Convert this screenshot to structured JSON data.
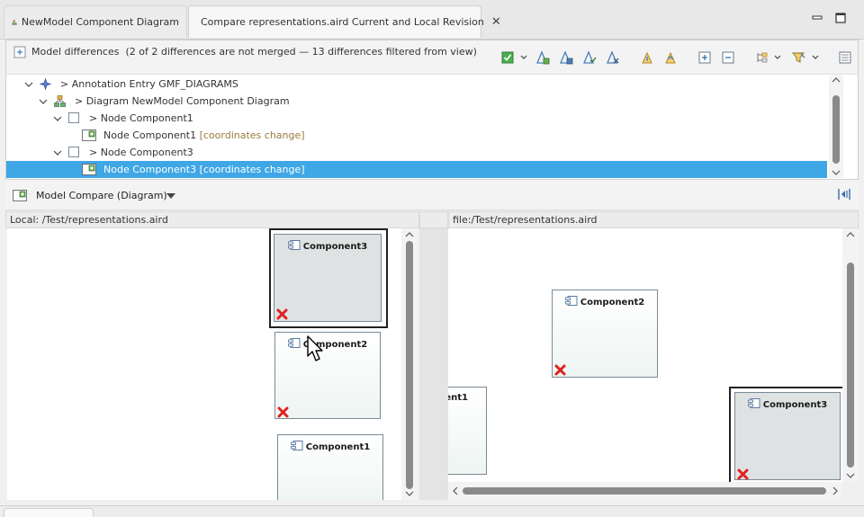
{
  "editor_tabs": [
    {
      "label": "NewModel Component Diagram",
      "active": false
    },
    {
      "label": "Compare representations.aird Current and Local Revision",
      "active": true
    }
  ],
  "model_differences": {
    "title": "Model differences",
    "status": "(2 of 2 differences are not merged — 13 differences filtered from view)",
    "tree": [
      {
        "text": "> Annotation Entry GMF_DIAGRAMS",
        "suffix": ""
      },
      {
        "text": "> Diagram  NewModel Component Diagram",
        "suffix": ""
      },
      {
        "text": "> Node Component1",
        "suffix": ""
      },
      {
        "text": "Node Component1",
        "suffix": "[coordinates change]"
      },
      {
        "text": "> Node Component3",
        "suffix": ""
      },
      {
        "text": "Node Component3",
        "suffix": "[coordinates change]",
        "selected": true
      }
    ]
  },
  "compare_viewer": {
    "title": "Model Compare (Diagram)",
    "left_pane_label": "Local: /Test/representations.aird",
    "right_pane_label": "file:/Test/representations.aird"
  },
  "diagram": {
    "left_nodes": [
      {
        "name": "Component3"
      },
      {
        "name": "Component2"
      },
      {
        "name": "Component1"
      }
    ],
    "right_nodes": [
      {
        "name": "Component2"
      },
      {
        "name": "nent1"
      },
      {
        "name": "Component3"
      }
    ]
  },
  "colors": {
    "selection": "#3fa7e6",
    "change_annotation": "#9a7c3b",
    "delete_marker": "#e02020"
  }
}
